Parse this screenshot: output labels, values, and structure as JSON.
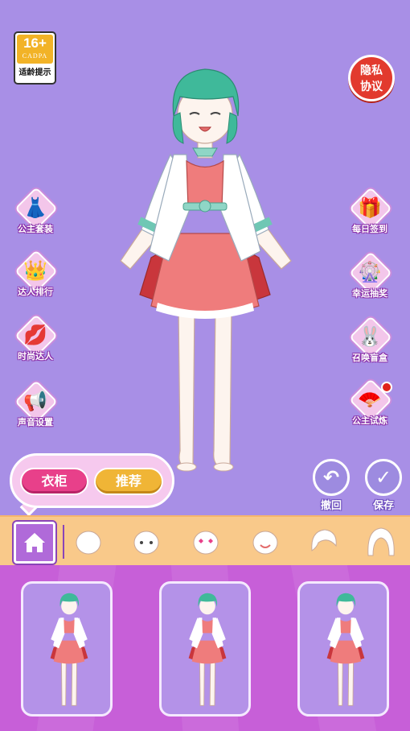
{
  "age_badge": {
    "age": "16+",
    "org": "CADPA",
    "label": "适龄提示"
  },
  "privacy_button": {
    "label_line1": "隐私",
    "label_line2": "协议"
  },
  "left_menu": [
    {
      "label": "公主套装",
      "icon": "dress-icon"
    },
    {
      "label": "达人排行",
      "icon": "crown-icon"
    },
    {
      "label": "时尚达人",
      "icon": "lips-icon"
    },
    {
      "label": "声音设置",
      "icon": "megaphone-icon"
    }
  ],
  "right_menu": [
    {
      "label": "每日签到",
      "icon": "gift-box-icon"
    },
    {
      "label": "幸运抽奖",
      "icon": "wheel-icon"
    },
    {
      "label": "召唤盲盒",
      "icon": "bunny-box-icon"
    },
    {
      "label": "公主试炼",
      "icon": "fan-icon",
      "badge": true
    }
  ],
  "actions": {
    "undo_label": "撤回",
    "save_label": "保存"
  },
  "bubble": {
    "wardrobe_label": "衣柜",
    "recommend_label": "推荐"
  },
  "categories": [
    {
      "name": "home",
      "icon": "home-icon",
      "selected": true
    },
    {
      "name": "face-base",
      "icon": "face-icon"
    },
    {
      "name": "eyes",
      "icon": "eyes-icon"
    },
    {
      "name": "blush",
      "icon": "heart-eyes-icon"
    },
    {
      "name": "mouth",
      "icon": "smile-icon"
    },
    {
      "name": "hair-front",
      "icon": "hair-icon"
    },
    {
      "name": "hair-back",
      "icon": "hair-back-icon"
    }
  ],
  "colors": {
    "background": "#a88fe6",
    "accent_pink": "#e8408a",
    "accent_gold": "#f0b536",
    "hair": "#3fb99a",
    "dress": "#ef7c7c"
  }
}
